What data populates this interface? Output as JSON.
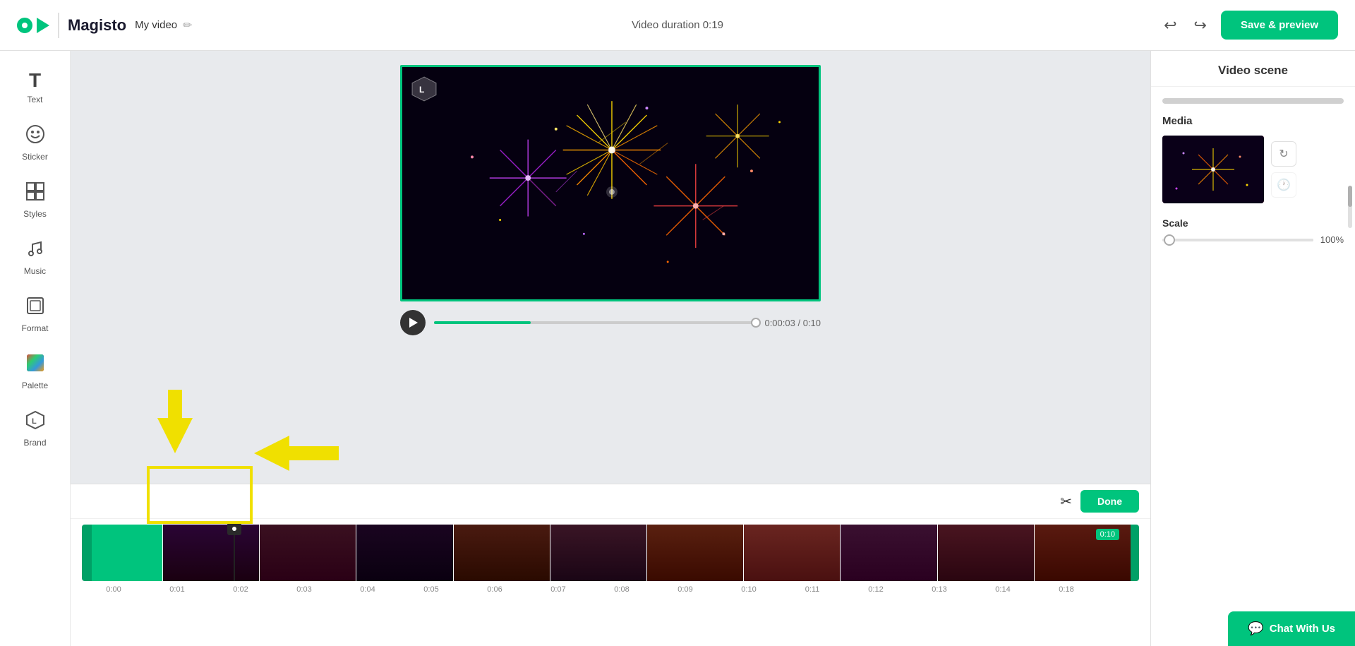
{
  "header": {
    "logo_text": "Magisto",
    "video_title": "My video",
    "video_duration_label": "Video duration 0:19",
    "save_preview_label": "Save & preview",
    "undo_icon": "↩",
    "redo_icon": "↪",
    "edit_icon": "✏"
  },
  "sidebar": {
    "items": [
      {
        "id": "text",
        "label": "Text",
        "icon": "T"
      },
      {
        "id": "sticker",
        "label": "Sticker",
        "icon": "◔"
      },
      {
        "id": "styles",
        "label": "Styles",
        "icon": "⊞"
      },
      {
        "id": "music",
        "label": "Music",
        "icon": "♪"
      },
      {
        "id": "format",
        "label": "Format",
        "icon": "▣"
      },
      {
        "id": "palette",
        "label": "Palette",
        "icon": "🎨"
      },
      {
        "id": "brand",
        "label": "Brand",
        "icon": "⬡"
      }
    ]
  },
  "right_panel": {
    "title": "Video scene",
    "media_label": "Media",
    "scale_label": "Scale",
    "scale_value": "100%",
    "refresh_icon": "↻",
    "clock_icon": "🕐"
  },
  "controls": {
    "time_current": "0:00:03",
    "time_total": "0:10"
  },
  "timeline": {
    "end_badge": "0:10",
    "time_marks": [
      "0:00",
      "0:01",
      "0:02",
      "0:03",
      "0:04",
      "0:05",
      "0:06",
      "0:07",
      "0:08",
      "0:09",
      "0:10",
      "0:11",
      "0:12",
      "0:13",
      "0:14",
      "0:18"
    ]
  },
  "bottom_toolbar": {
    "scissors_label": "scissors",
    "done_label": "Done"
  },
  "chat": {
    "label": "Chat With Us"
  }
}
